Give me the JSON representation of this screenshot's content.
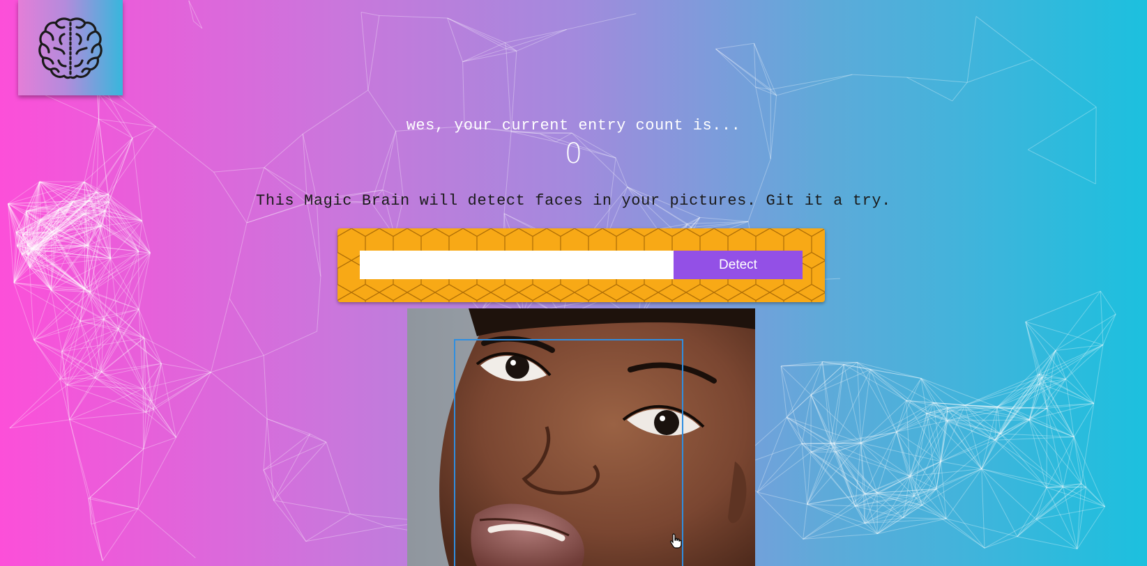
{
  "app": {
    "logo_icon": "brain-icon"
  },
  "rank": {
    "greeting": "wes, your current entry count is...",
    "count": "0"
  },
  "intro_text": "This Magic Brain will detect faces in your pictures. Git it a try.",
  "image_form": {
    "input_value": "",
    "input_placeholder": "",
    "detect_label": "Detect"
  },
  "face_recognition": {
    "image_description_icon": "face-photo",
    "box_color": "#2f8ee0"
  },
  "colors": {
    "gradient_left": "#fc4fd9",
    "gradient_right": "#1cc0de",
    "form_panel": "#f8a916",
    "detect_button": "#9350e6"
  }
}
